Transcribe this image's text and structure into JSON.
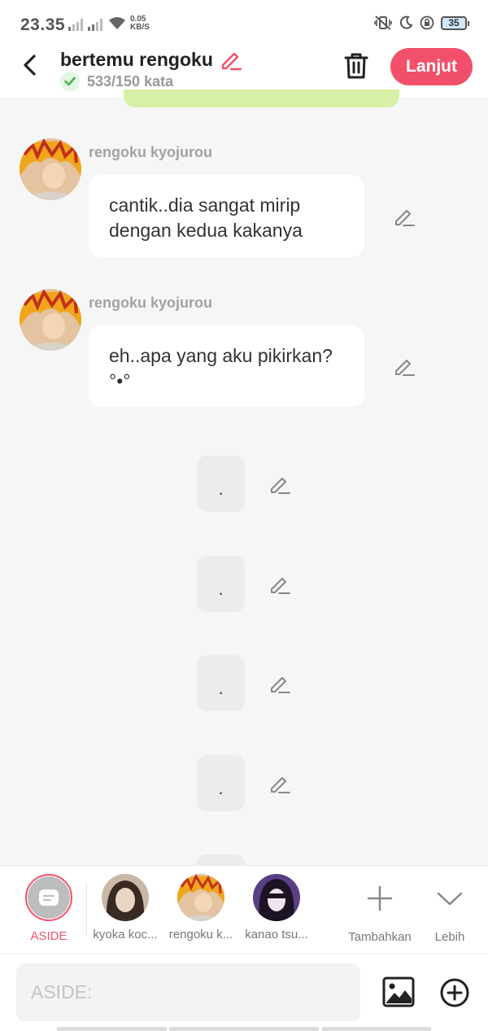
{
  "status_bar": {
    "time": "23.35",
    "net_speed_value": "0.05",
    "net_speed_unit": "KB/S",
    "battery": "35"
  },
  "header": {
    "title": "bertemu rengoku",
    "word_count": "533/150 kata",
    "next_label": "Lanjut"
  },
  "messages": [
    {
      "sender": "rengoku kyojurou",
      "text": "cantik..dia sangat mirip dengan kedua kakanya"
    },
    {
      "sender": "rengoku kyojurou",
      "text": "eh..apa yang aku pikirkan? °•°"
    }
  ],
  "aside_messages": [
    ".",
    ".",
    ".",
    "."
  ],
  "characters": {
    "aside": "ASIDE",
    "list": [
      "kyoka koc...",
      "rengoku k...",
      "kanao tsu..."
    ],
    "add_label": "Tambahkan",
    "more_label": "Lebih"
  },
  "input": {
    "placeholder": "ASIDE:"
  },
  "colors": {
    "accent": "#f2506a",
    "background": "#f6f6f6",
    "bubble": "#ffffff"
  }
}
